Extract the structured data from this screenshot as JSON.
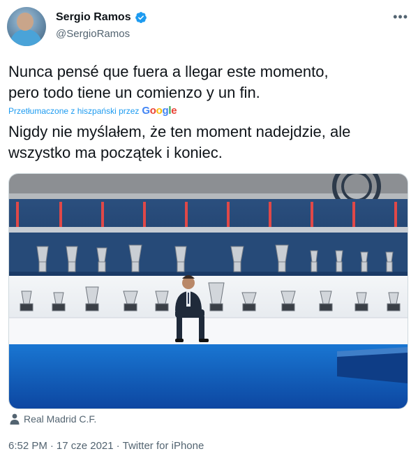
{
  "author": {
    "display_name": "Sergio Ramos",
    "handle": "@SergioRamos",
    "verified": true
  },
  "tweet": {
    "original_lines": [
      "Nunca pensé que fuera a llegar este momento,",
      "pero todo tiene un comienzo y un fin."
    ],
    "translated_label": "Przetłumaczone z hiszpański przez",
    "translation_provider": "Google",
    "translation_lines": [
      "Nigdy nie myślałem, że ten moment nadejdzie, ale",
      "wszystko ma początek i koniec."
    ]
  },
  "media": {
    "tagged_account": "Real Madrid C.F."
  },
  "meta": {
    "time": "6:52 PM",
    "separator": "·",
    "date": "17 cze 2021",
    "source": "Twitter for iPhone"
  },
  "colors": {
    "accent": "#1d9bf0",
    "secondary_text": "#536471",
    "stadium_seats": "#1f5fa8",
    "carpet": "#1565c0"
  },
  "icons": {
    "verified": "verified-badge-icon",
    "more": "more-options-icon",
    "tag": "person-tag-icon"
  }
}
